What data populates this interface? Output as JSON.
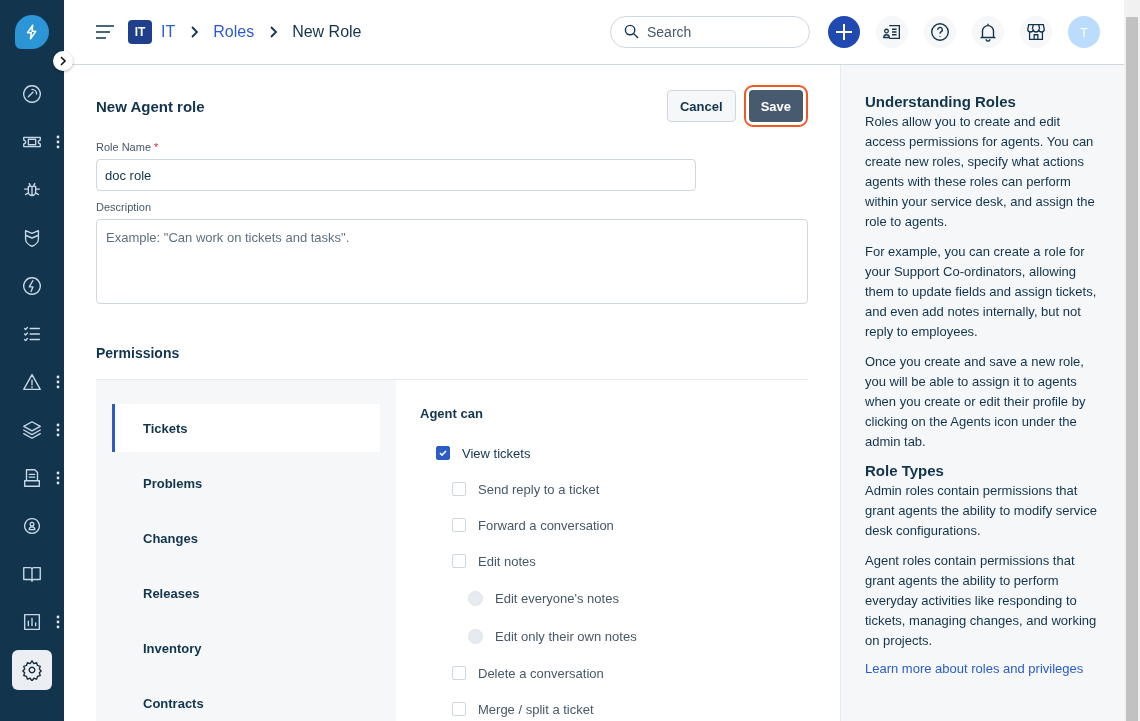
{
  "sidebar": {
    "items": [
      {
        "selected": false,
        "more": false
      },
      {
        "selected": false,
        "more": true
      },
      {
        "selected": false,
        "more": false
      },
      {
        "selected": false,
        "more": false
      },
      {
        "selected": false,
        "more": false
      },
      {
        "selected": false,
        "more": false
      },
      {
        "selected": false,
        "more": true
      },
      {
        "selected": false,
        "more": true
      },
      {
        "selected": false,
        "more": true
      },
      {
        "selected": false,
        "more": false
      },
      {
        "selected": false,
        "more": false
      },
      {
        "selected": false,
        "more": true
      },
      {
        "selected": true,
        "more": false
      }
    ]
  },
  "breadcrumb": {
    "workspace_badge": "IT",
    "items": [
      "IT",
      "Roles"
    ],
    "current": "New Role"
  },
  "search": {
    "placeholder": "Search"
  },
  "avatar": "T",
  "form": {
    "title": "New Agent role",
    "cancel": "Cancel",
    "save": "Save",
    "role_name": {
      "label": "Role Name",
      "required_mark": "*",
      "value": "doc role"
    },
    "description": {
      "label": "Description",
      "placeholder": "Example: \"Can work on tickets and tasks\"."
    }
  },
  "permissions": {
    "title": "Permissions",
    "tabs": [
      {
        "label": "Tickets",
        "selected": true
      },
      {
        "label": "Problems",
        "selected": false
      },
      {
        "label": "Changes",
        "selected": false
      },
      {
        "label": "Releases",
        "selected": false
      },
      {
        "label": "Inventory",
        "selected": false
      },
      {
        "label": "Contracts",
        "selected": false
      }
    ],
    "heading": "Agent can",
    "items": [
      {
        "kind": "checkbox",
        "label": "View tickets",
        "checked": true,
        "children": [
          {
            "kind": "checkbox",
            "label": "Send reply to a ticket",
            "checked": false
          },
          {
            "kind": "checkbox",
            "label": "Forward a conversation",
            "checked": false
          },
          {
            "kind": "checkbox",
            "label": "Edit notes",
            "checked": false,
            "children": [
              {
                "kind": "radio",
                "label": "Edit everyone's notes",
                "selected": false
              },
              {
                "kind": "radio",
                "label": "Edit only their own notes",
                "selected": false
              }
            ]
          },
          {
            "kind": "checkbox",
            "label": "Delete a conversation",
            "checked": false
          },
          {
            "kind": "checkbox",
            "label": "Merge / split a ticket",
            "checked": false
          }
        ]
      }
    ]
  },
  "help": {
    "sections": [
      {
        "title": "Understanding Roles",
        "paragraphs": [
          "Roles allow you to create and edit access permissions for agents. You can create new roles, specify what actions agents with these roles can perform within your service desk, and assign the role to agents.",
          "For example, you can create a role for your Support Co-ordinators, allowing them to update fields and assign tickets, and even add notes internally, but not reply to employees.",
          "Once you create and save a new role, you will be able to assign it to agents when you create or edit their profile by clicking on the Agents icon under the admin tab."
        ]
      },
      {
        "title": "Role Types",
        "paragraphs": [
          "Admin roles contain permissions that grant agents the ability to modify service desk configurations.",
          "Agent roles contain permissions that grant agents the ability to perform everyday activities like responding to tickets, managing changes, and working on projects."
        ]
      }
    ],
    "link": "Learn more about roles and privileges"
  }
}
